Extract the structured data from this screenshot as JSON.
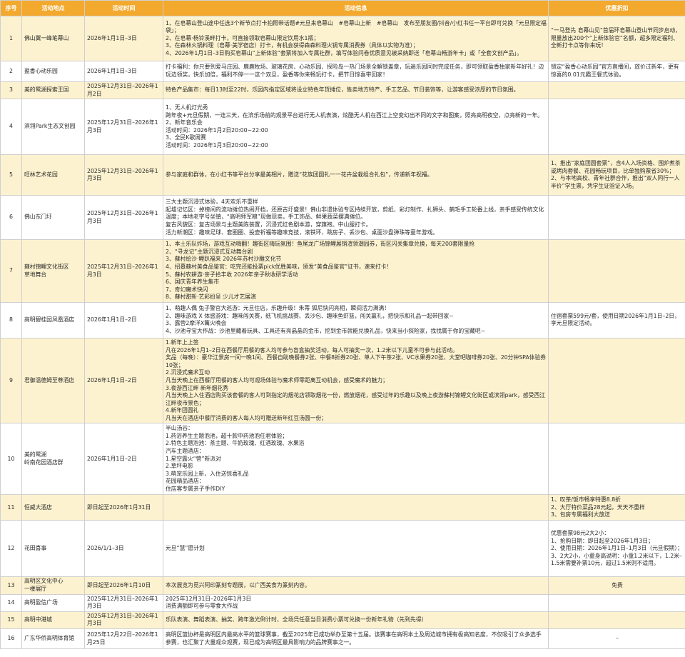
{
  "columns": [
    "序号",
    "活动地点",
    "活动时间",
    "活动信息",
    "优惠折扣"
  ],
  "rows": [
    {
      "no": "1",
      "name": "佛山翼一峰笔幕山",
      "time": "2026年1月1日–3日",
      "info": "1、在皂幕山登山途中任选3个新节点打卡拍照带话题#元旦来皂幕山　#皂幕山上新　#皂幕山　发布至朋友圈/抖音/小红书任一平台即可兑换「元旦限定福袋」；\n2、在皂幕·杨铃溪畔打卡，可直接领取皂幕山限定饮用水1瓶；\n3、在森林火锅料理（皂幕·美学宿店）打卡，有机会获得森森料理火锅专属消费券（具体以实物为准）；\n4、2026年1月1日–3日购买皂幕山“上新体验”套票将加入专属社群，填写体验问卷优质意见被采纳即送「皂幕山畅游年卡」或「全套文创产品」。",
      "offer": "“一马登先 皂幕山见”首届环皂幕山登山节同步启动，限量放出200个“上新体验官”名额，超多限定福利、全新打卡点等你来玩！",
      "h": 63
    },
    {
      "no": "2",
      "name": "盈香心动乐园",
      "time": "2026年1月1日–3日",
      "info": "打卡福利：你只要到爱马庄园、鹿鹿牧场、玻璃花房、心动乐园、探险岛一热门场景全解锁盖章，玩遍乐园同时完成任务，即可领取盈香独家新年好礼！边玩边领奖，快乐加倍，福利不停一一这个双旦，盈香等你来畅玩打卡，把节日惊喜带回家！",
      "offer": "锁定“盈香心动乐园”官方直播间，放价过新年，更有惊喜的0.01元霸王餐式体验。",
      "h": 29
    },
    {
      "no": "3",
      "name": "美的鹭湖探索王国",
      "time": "2025年12月31日–2026年1月2日",
      "info": "特色产品集市：每日13时至22时，乐园内指定区域将设立特色年货摊位，售卖地方特产、手工艺品、节日装饰等，让游客感受浓厚的节日氛围。",
      "offer": "",
      "h": 21
    },
    {
      "no": "4",
      "name": "滨翎Park生态文创园",
      "time": "2025年12月31日–2026年1月3日",
      "info": "1、无人机灯光秀\n跨年夜+元旦假期，一连三天，在滨乐场前的观景平台进行无人机表演，炫酷无人机在西江上空变幻出不同的文字和图案，照亮高明夜空，点亮新的一年。\n2、新年音乐会\n活动时间：2026年1月2日20:00~22:00\n3、全民K歌周赛\n活动时间：2026年1月3日20:00~22:00",
      "offer": "",
      "h": 78
    },
    {
      "no": "5",
      "name": "旺林艺术花园",
      "time": "2025年12月31日–2026年1月3日",
      "info": "参与家庭和群体，在小红书等平台分享最美相片，赠送“花族团圆礼一一花卉盆栽组合礼包”，传递新年祝福。",
      "offer": "1、推出“家庭团圆套票”，含4人入场资格、围炉煮茶或烤肉套餐、花园畅玩项目，比单独购票省30%；\n2、与本地高校、青年社群合作，推出“双人同行一人半价”学生票，凭学生证验证入场。",
      "h": 57
    },
    {
      "no": "6",
      "name": "佛山东门圩",
      "time": "2025年12月31日–2026年1月3日",
      "info": "三大主题沉浸式体验，4天欢乐不重样\n起墟记忆区：掉榜间的流动摊位热闹开档，还原古圩盛景！佛山非遗体验专区持续开放，剪纸、彩灯制作、扎狮头、鹤毛手工轮番上线，亲手感受传统文化温度；本地老字号坐镇，“高明师军粮”现做现卖，手工饰品、鲜果蔬菜摆满摊位。\n复古风貌区：复古场景与主题美陈装置，沉浸式红色剧本游，穿旗袍、中山服打卡。\n活力新潮区：趣味足球、套圈圈、投壶祈福等趣味竞技，滚铁环、跳房子、丢沙包、桌面沙盘弹珠等童年游戏。",
      "offer": "",
      "h": 62
    },
    {
      "no": "7",
      "name": "蘇村锦鲤文化街区\n草地舞台",
      "time": "2025年12月31日–2026年1月3日",
      "info": "1、本土乐队炸场，游戏互动嗨翻！趣街区嗨玩氛围！鱼尾龙广场锦鲤展销渲领潮园券，街区闪关集章兑换，每天200套限量抢\n2、“寻龙记”主题沉浸式互动舞台剧\n3、蘇村绘沙·鲤趴福来 2026年苏村沙雕文化节\n4、招募蘇村美食品鉴官：吃完还能投票pick优胜美味，颁发“美食品鉴官”证书，速来打卡！\n5、蘇村农耕游·亲子拾丰收 2026年亲子秋收研学活动\n6、国庆青年养生集市\n7、奇幻魔术快闪\n8、蘇村甜新·艺彩纷呈 少儿才艺展演",
      "offer": "",
      "h": 86
    },
    {
      "no": "8",
      "name": "高明碧桂园凤凰酒店",
      "time": "2026年1月1日–2日",
      "info": "1、萌趣人偶 兔子警官大巡游：元旦住店，乐趣升级！朱蒂 狐尼快闪亮相，瞬间活力满满！\n2、趣味游戏 X 体感游戏：趣味闯关赛，纸飞机挑战赛、丢沙包、趣味鱼虾篮，闯关赢礼，把快乐和礼品一起带回家~\n3、露营2摩洋X篝火晚会\n4、沙池寻宝大作战：沙池里藏着玩具、工具还有亮晶晶的金币，挖到金币就能兑换礼品，快来当小探险家，找找属于你的宝藏吧~",
      "offer": "住宿套票599元/套，使用日期2026年1月1日–2日，享元旦限定活动。",
      "h": 50
    },
    {
      "no": "9",
      "name": "君御温德姆至尊酒店",
      "time": "2026年1月1日–2日",
      "info": "1.新年上上签\n凡在2026年1月1–2日在西餐厅用餐的客人均可参与盲盒抽奖活动，每人可抽奖一次，1.2米以下儿童不可参与此活动。\n奖品（每晚）：豪华江景房一间一晚1间、西餐自助晚餐券2张、中餐8折券20张、单人下午茶2张、VC水果券20张、大堂吧咖啡券20张、20分钟SPA体验券10张；\n2.沉浸式魔术互动\n凡当天晚上在西餐厅用餐的客人均可观场体验与魔术师零距离互动机会，感受魔术的魅力；\n3.夜游西江畔 新年烟花秀\n凡当天晚上入住酒店购买该套餐的客人可到指定的烟花店领取烟花一份，燃放烟花，感受过年的乐趣以及晚上夜游蘇村锦鲤文化街区或滨翎park，感受西江江畔夜市景色；\n4.新年团圆礼\n凡当天在酒店中餐厅消费的客人每人均可赠送新年红豆汤圆一份；",
      "offer": "",
      "h": 115
    },
    {
      "no": "10",
      "name": "美的鹭湖\n岭南花园酒店群",
      "time": "2026年1月1日–2日",
      "info": "半山汤谷：\n1.药浴养生主题泡池，超十款中药池泡任君体验；\n2.特色主题泡池：茶主题、牛奶玫瑰、红酒玫瑰、水果浴\n汽车主题酒店：\n1.星空露火“营”新派对\n2.草坪电影\n3.萌宠乐园上新，入住送惊喜礼品\n花园精品酒店：\n住店客专属亲子手作DIY",
      "offer": "",
      "h": 100
    },
    {
      "no": "11",
      "name": "恒威大酒店",
      "time": "即日起至2026年1月31日",
      "info": "",
      "offer": "1、叹茶/饭市畅享特惠8.8折\n2、大厅特价菜品28元起，天天不重样\n3、包房专属福利大放送",
      "h": 36
    },
    {
      "no": "12",
      "name": "花田喜事",
      "time": "2026/1/1–3日",
      "info": "元旦“慧”愿计划",
      "offer": "优惠套票98元2大2小：\n1、抢购日期：即日起至2026年1月3日；\n2、使用日期：2026年1月1日–1月3日（元旦假期）；\n3、2大2小，小童身高说明：小童1.2米以下，1.2米–1.5米需要补票10元，超过1.5米则不适用。",
      "h": 79
    },
    {
      "no": "13",
      "name": "高明区文化中心\n一楼展厅",
      "time": "即日起至2026年1月10日",
      "info": "本次展览为觅兴阿印篆刻专题展，以广西美食为篆刻内容。",
      "offer": "免费",
      "offer_center": true,
      "h": 24
    },
    {
      "no": "14",
      "name": "高明盈信广场",
      "time": "2025年12月31日–2026年1月3日",
      "info": "2025年12月31日–2026年1月3日\n消费满额即可参与零食大作战",
      "offer": "",
      "h": 24
    },
    {
      "no": "15",
      "name": "高明中港城",
      "time": "2025年12月31日–2026年1月3日",
      "info": "乐队表演、舞蹈表演、抽奖、跨年激光倒计时、全场凭任意当日消费小票可兑换一份新年礼物（先到先得）",
      "offer": "",
      "h": 22
    },
    {
      "no": "16",
      "name": "广东华侨高明体育馆",
      "time": "2025年12月22日–2026年1月25日",
      "info": "高明区篮协杯是高明区内最高水平的篮球赛事，截至2025年已成功举办至第十五届。该赛事在高明本土及周边城市拥有极高知名度，不仅吸引了众多选手参赛，也汇聚了大量观众观赛，现已成为高明区最具影响力的品牌赛事之一。",
      "offer": "–",
      "offer_center": true,
      "h": 28
    }
  ]
}
